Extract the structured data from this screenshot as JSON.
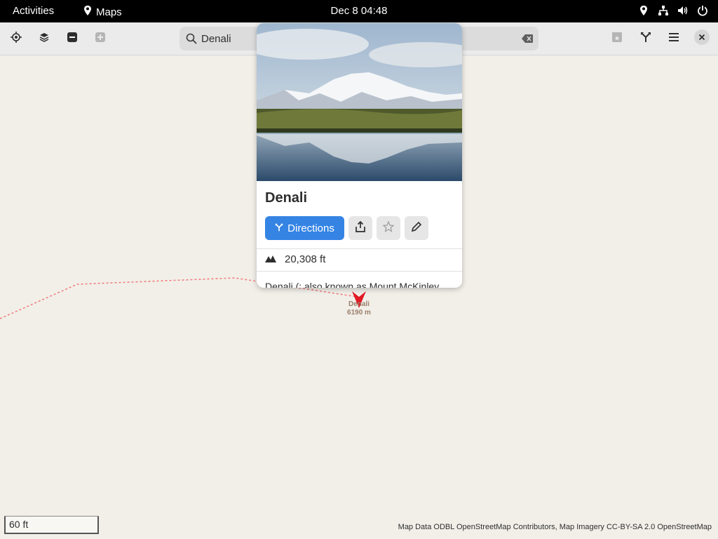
{
  "topbar": {
    "activities": "Activities",
    "app_name": "Maps",
    "clock": "Dec 8  04:48",
    "tray_icons": [
      "location-icon",
      "network-icon",
      "volume-icon",
      "power-icon"
    ]
  },
  "headerbar": {
    "left_buttons": [
      "locate-icon",
      "layers-icon",
      "zoom-out-icon",
      "zoom-in-icon"
    ],
    "search": {
      "value": "Denali",
      "placeholder": ""
    },
    "right_buttons": [
      "favorites-icon",
      "route-icon",
      "main-menu-icon",
      "close-icon"
    ]
  },
  "map": {
    "marker_name": "Denali",
    "marker_elevation": "6190 m",
    "scale": "60 ft",
    "attribution": "Map Data ODBL OpenStreetMap Contributors, Map Imagery CC-BY-SA 2.0 OpenStreetMap",
    "route_color": "#f08080",
    "marker_color": "#e01b24"
  },
  "popover": {
    "title": "Denali",
    "directions_label": "Directions",
    "elevation": "20,308 ft",
    "description": "Denali (; also known as Mount McKinley",
    "accent": "#3584e4"
  }
}
